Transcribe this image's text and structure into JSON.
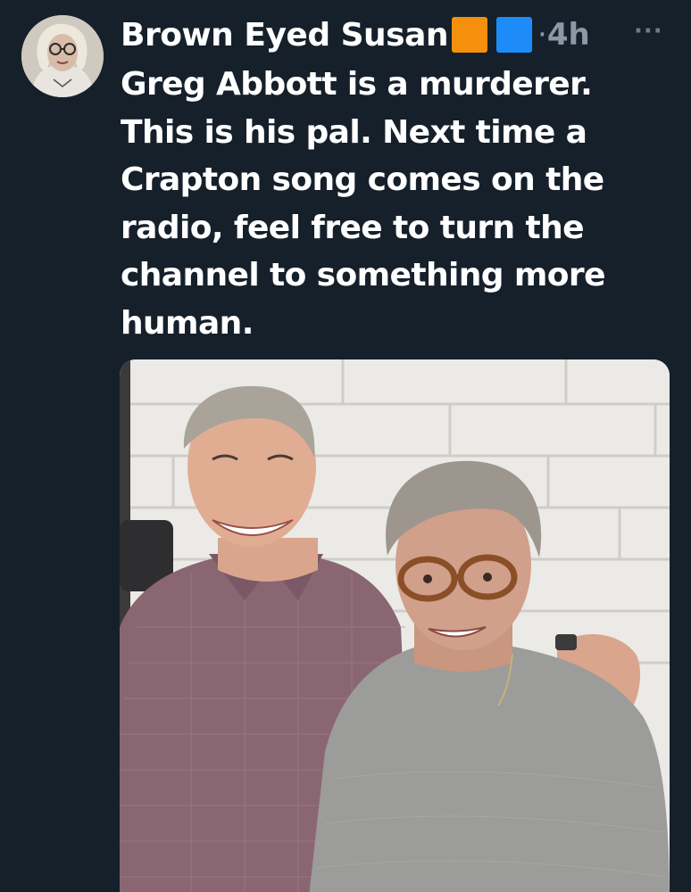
{
  "post": {
    "author_name": "Brown Eyed Susan",
    "flag_colors": [
      "#f4900c",
      "#1d8cf8"
    ],
    "dot": "·",
    "time": "4h",
    "more_label": "···",
    "text": "Greg Abbott is a murderer.\nThis is his pal. Next time a\nCrapton song comes on the\nradio, feel free to turn the\nchannel to something more\nhuman."
  },
  "icons": {
    "avatar": "avatar-portrait",
    "more": "more-options-icon"
  }
}
